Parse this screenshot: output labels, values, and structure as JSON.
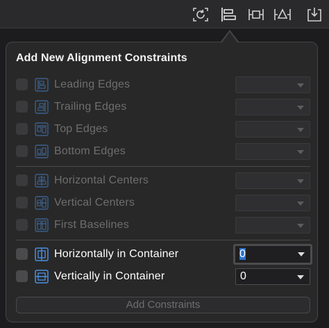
{
  "toolbar": {
    "buttons": [
      {
        "name": "update-frames-icon"
      },
      {
        "name": "align-icon"
      },
      {
        "name": "add-constraints-icon"
      },
      {
        "name": "resolve-issues-icon"
      },
      {
        "name": "embed-in-icon"
      }
    ]
  },
  "popover": {
    "title": "Add New Alignment Constraints",
    "edges": [
      {
        "label": "Leading Edges",
        "enabled": false,
        "value": ""
      },
      {
        "label": "Trailing Edges",
        "enabled": false,
        "value": ""
      },
      {
        "label": "Top Edges",
        "enabled": false,
        "value": ""
      },
      {
        "label": "Bottom Edges",
        "enabled": false,
        "value": ""
      }
    ],
    "centers": [
      {
        "label": "Horizontal Centers",
        "enabled": false,
        "value": ""
      },
      {
        "label": "Vertical Centers",
        "enabled": false,
        "value": ""
      },
      {
        "label": "First Baselines",
        "enabled": false,
        "value": ""
      }
    ],
    "container": [
      {
        "label": "Horizontally in Container",
        "enabled": true,
        "value": "0",
        "focused": true
      },
      {
        "label": "Vertically in Container",
        "enabled": true,
        "value": "0",
        "focused": false
      }
    ],
    "add_button_label": "Add Constraints"
  },
  "colors": {
    "focus": "#2d72c9",
    "icon_enabled": "#4a8fe0",
    "icon_disabled": "#3c5f8a"
  }
}
